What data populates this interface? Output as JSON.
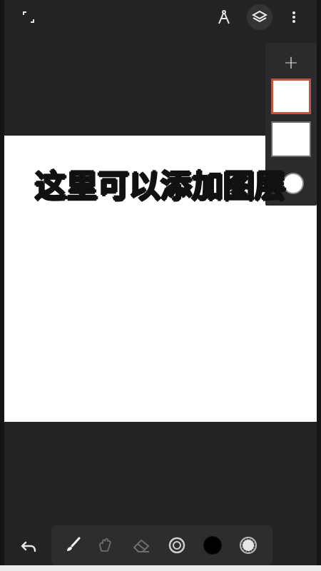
{
  "app": {
    "canvas_color": "#ffffff",
    "background_color": "#232326",
    "accent_color": "#c0563a"
  },
  "topbar": {
    "icons": [
      "fullscreen-icon",
      "ruler-compass-icon",
      "layers-icon",
      "more-vert-icon"
    ]
  },
  "overlay": {
    "caption": "这里可以添加图层"
  },
  "layers_panel": {
    "add_label": "+",
    "layers": [
      {
        "name": "layer-1",
        "selected": true
      },
      {
        "name": "layer-2",
        "selected": false
      }
    ]
  },
  "bottombar": {
    "undo_icon": "undo-icon",
    "tools": [
      "brush-icon",
      "smudge-icon",
      "eraser-icon",
      "brush-size-icon",
      "color-icon",
      "opacity-icon"
    ],
    "current_color": "#000000"
  }
}
